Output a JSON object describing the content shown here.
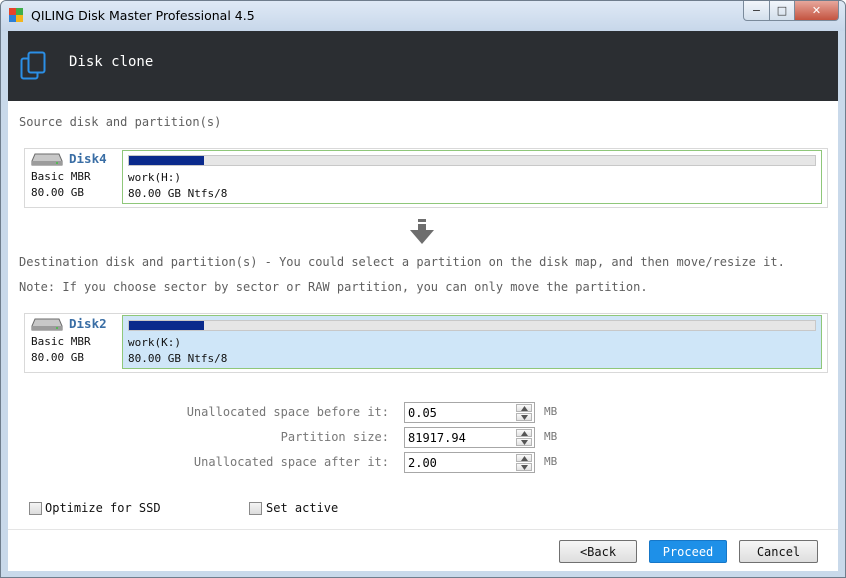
{
  "window": {
    "title": "QILING Disk Master Professional 4.5",
    "controls": {
      "minimize": "−",
      "maximize": "□",
      "close": "✕"
    }
  },
  "header": {
    "title": "Disk clone",
    "icon": "clone-icon"
  },
  "source": {
    "label": "Source disk and partition(s)",
    "disk": {
      "name": "Disk4",
      "type": "Basic MBR",
      "size": "80.00 GB",
      "partition": {
        "name": "work(H:)",
        "info": "80.00 GB Ntfs/8",
        "used_fraction": 0.11
      }
    }
  },
  "destination": {
    "label": "Destination disk and partition(s) - You could select a partition on the disk map, and then move/resize it.",
    "note": "Note: If you choose sector by sector or RAW partition, you can only move the partition.",
    "disk": {
      "name": "Disk2",
      "type": "Basic MBR",
      "size": "80.00 GB",
      "partition": {
        "name": "work(K:)",
        "info": "80.00 GB Ntfs/8",
        "used_fraction": 0.11
      }
    }
  },
  "fields": {
    "before": {
      "label": "Unallocated space before it:",
      "value": "0.05",
      "unit": "MB"
    },
    "size": {
      "label": "Partition size:",
      "value": "81917.94",
      "unit": "MB"
    },
    "after": {
      "label": "Unallocated space after it:",
      "value": "2.00",
      "unit": "MB"
    }
  },
  "options": {
    "optimize_ssd": {
      "label": "Optimize for SSD",
      "checked": false
    },
    "set_active": {
      "label": "Set active",
      "checked": false
    }
  },
  "buttons": {
    "back": "<Back",
    "proceed": "Proceed",
    "cancel": "Cancel"
  },
  "colors": {
    "header_bg": "#2b2e32",
    "accent": "#1e90e8",
    "bar_fill": "#0a2a8c",
    "partition_border": "#8fc77a",
    "selected_partition": "#cfe6f8"
  }
}
